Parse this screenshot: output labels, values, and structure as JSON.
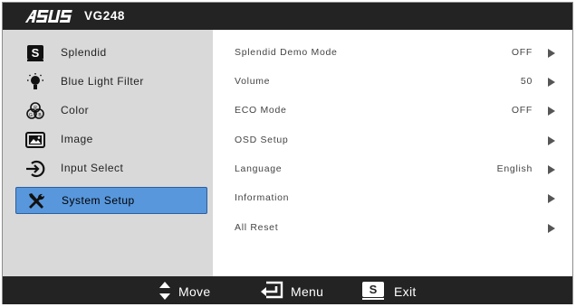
{
  "header": {
    "brand": "ASUS",
    "model": "VG248"
  },
  "menu": [
    {
      "label": "Splendid",
      "icon": "splendid-s-icon",
      "selected": false
    },
    {
      "label": "Blue Light Filter",
      "icon": "bulb-icon",
      "selected": false
    },
    {
      "label": "Color",
      "icon": "color-rgb-icon",
      "selected": false
    },
    {
      "label": "Image",
      "icon": "image-icon",
      "selected": false
    },
    {
      "label": "Input Select",
      "icon": "input-select-icon",
      "selected": false
    },
    {
      "label": "System Setup",
      "icon": "tools-icon",
      "selected": true
    }
  ],
  "settings": [
    {
      "label": "Splendid Demo Mode",
      "value": "OFF"
    },
    {
      "label": "Volume",
      "value": "50"
    },
    {
      "label": "ECO Mode",
      "value": "OFF"
    },
    {
      "label": "OSD Setup",
      "value": ""
    },
    {
      "label": "Language",
      "value": "English"
    },
    {
      "label": "Information",
      "value": ""
    },
    {
      "label": "All Reset",
      "value": ""
    }
  ],
  "footer": {
    "move_label": "Move",
    "menu_label": "Menu",
    "exit_label": "Exit",
    "exit_key": "S"
  },
  "colors": {
    "bar": "#232323",
    "panel": "#d9d9d9",
    "selected": "#5897dc",
    "text": "#444444"
  }
}
